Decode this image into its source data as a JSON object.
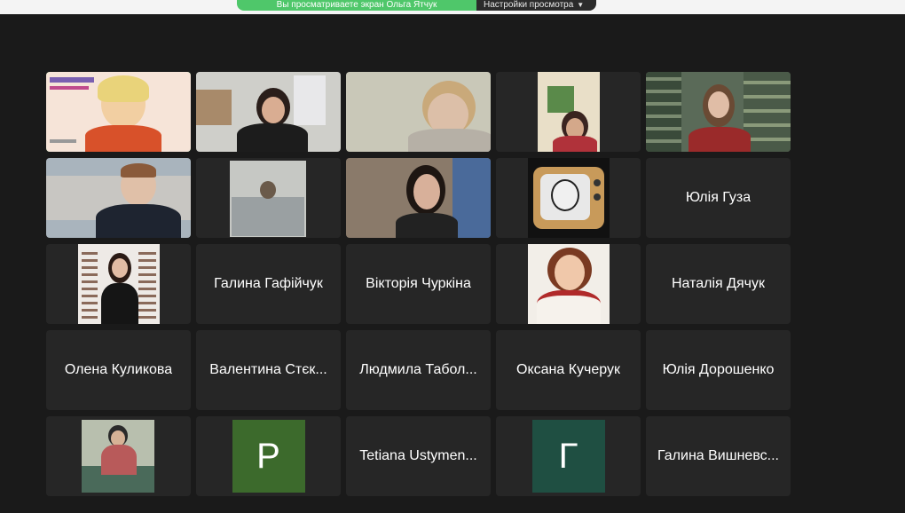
{
  "banner": {
    "share_text": "Вы просматриваете экран Ольга Ятчук",
    "view_options_label": "Настройки просмотра"
  },
  "participants": [
    {
      "name": "",
      "kind": "video",
      "active": true
    },
    {
      "name": "",
      "kind": "video"
    },
    {
      "name": "",
      "kind": "video"
    },
    {
      "name": "",
      "kind": "video"
    },
    {
      "name": "",
      "kind": "video"
    },
    {
      "name": "",
      "kind": "video"
    },
    {
      "name": "",
      "kind": "video"
    },
    {
      "name": "",
      "kind": "video"
    },
    {
      "name": "",
      "kind": "video"
    },
    {
      "name": "Юлія Гуза",
      "kind": "name"
    },
    {
      "name": "",
      "kind": "video"
    },
    {
      "name": "Галина Гафійчук",
      "kind": "name"
    },
    {
      "name": "Вікторія Чуркіна",
      "kind": "name"
    },
    {
      "name": "",
      "kind": "video"
    },
    {
      "name": "Наталія Дячук",
      "kind": "name"
    },
    {
      "name": "Олена Куликова",
      "kind": "name"
    },
    {
      "name": "Валентина Стєк...",
      "kind": "name"
    },
    {
      "name": "Людмила Табол...",
      "kind": "name"
    },
    {
      "name": "Оксана Кучерук",
      "kind": "name"
    },
    {
      "name": "Юлія Дорошенко",
      "kind": "name"
    },
    {
      "name": "",
      "kind": "video"
    },
    {
      "name": "",
      "kind": "avatar",
      "letter": "P",
      "color": "#3c6a2c"
    },
    {
      "name": "Tetiana Ustymen...",
      "kind": "name"
    },
    {
      "name": "",
      "kind": "avatar",
      "letter": "Г",
      "color": "#1f4f42"
    },
    {
      "name": "Галина Вишневс...",
      "kind": "name"
    }
  ]
}
